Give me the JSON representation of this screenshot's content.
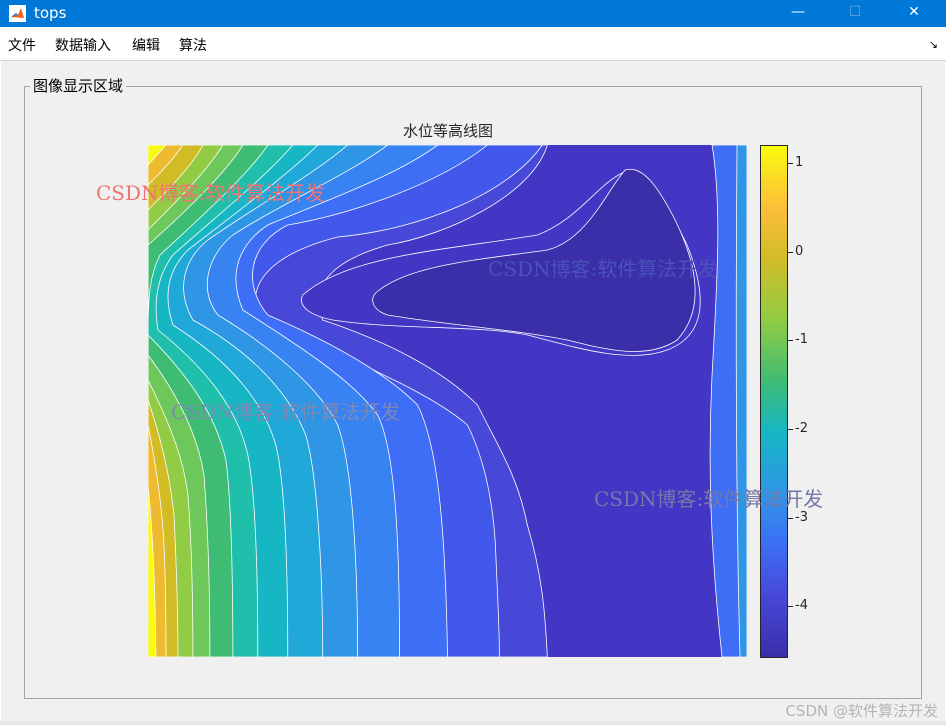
{
  "window": {
    "title": "tops",
    "minimize_glyph": "—",
    "maximize_glyph": "☐",
    "close_glyph": "✕",
    "title_bar_color": "#0078d7"
  },
  "menu": {
    "items": [
      "文件",
      "数据输入",
      "编辑",
      "算法"
    ],
    "toolbar_toggle_glyph": "↘"
  },
  "panel": {
    "title": "图像显示区域"
  },
  "chart_data": {
    "type": "contour",
    "title": "水位等高线图",
    "xlabel": "",
    "ylabel": "",
    "colormap": "parula",
    "filled": true,
    "contour_line_color": "#ffffff",
    "colorbar": {
      "ticks": [
        1,
        0,
        -1,
        -2,
        -3,
        -4
      ],
      "tick_labels": [
        "1",
        "0",
        "-1",
        "-2",
        "-3",
        "-4"
      ],
      "lim": [
        -4.6,
        1.2
      ]
    },
    "axis_ticks_visible": false,
    "level_colors": [
      "#3a2ea9",
      "#4436c4",
      "#4748d8",
      "#4258ea",
      "#3d6ef5",
      "#3783f2",
      "#2f96e6",
      "#20a8d8",
      "#16b6c4",
      "#20bfac",
      "#3fbc73",
      "#6ec75a",
      "#91cc44",
      "#b5c62f",
      "#d2bc26",
      "#eeba30",
      "#fcbf3a",
      "#f3e62a",
      "#f9fb0e"
    ]
  },
  "watermarks": [
    {
      "text": "CSDN博客:软件算法开发",
      "color": "#ef7373"
    },
    {
      "text": "CSDN博客:软件算法开发",
      "color": "#4a52b8"
    },
    {
      "text": "CSDN博客:软件算法开发",
      "color": "#7d88b8"
    },
    {
      "text": "CSDN博客:软件算法开发",
      "color": "#7378a8"
    }
  ],
  "footer_watermark": "CSDN @软件算法开发"
}
